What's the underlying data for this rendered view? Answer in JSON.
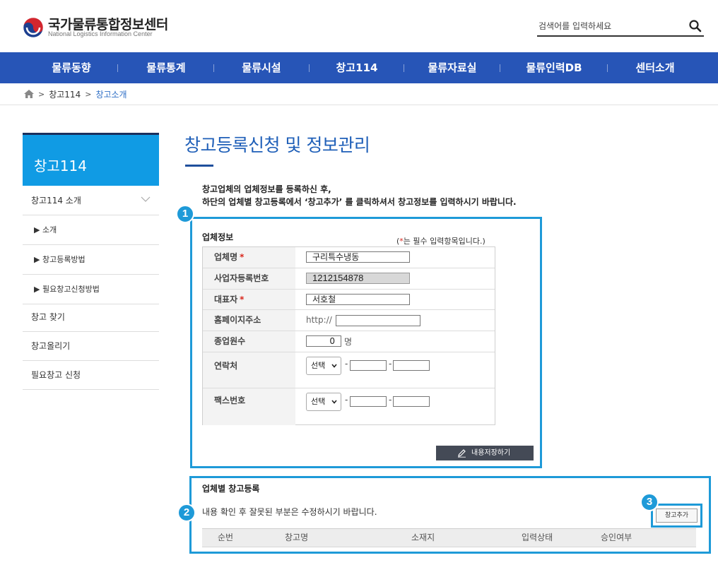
{
  "header": {
    "logo_ko": "국가물류통합정보센터",
    "logo_en": "National Logistics Information Center",
    "search_placeholder": "검색어를 입력하세요"
  },
  "nav": {
    "items": [
      "물류동향",
      "물류통계",
      "물류시설",
      "창고114",
      "물류자료실",
      "물류인력DB",
      "센터소개"
    ]
  },
  "breadcrumb": {
    "items": [
      "창고114",
      "창고소개"
    ]
  },
  "sidebar": {
    "title": "창고114",
    "items": [
      {
        "label": "창고114 소개"
      },
      {
        "label": "▶ 소개"
      },
      {
        "label": "▶ 창고등록방법"
      },
      {
        "label": "▶ 필요창고신청방법"
      },
      {
        "label": "창고 찾기"
      },
      {
        "label": "창고올리기"
      },
      {
        "label": "필요창고 신청"
      }
    ]
  },
  "main": {
    "title": "창고등록신청 및 정보관리",
    "intro_line1": "창고업체의 업체정보를 등록하신 후,",
    "intro_line2": "하단의 업체별 창고등록에서 ‘창고추가’ 를 클릭하셔서 창고정보를 입력하시기 바랍니다."
  },
  "company_info": {
    "section_title": "업체정보",
    "required_note_open": "(",
    "required_note_star": "*",
    "required_note_text": "는 필수 입력항목입니다.)",
    "fields": {
      "company_name": {
        "label": "업체명",
        "value": "구리특수냉동"
      },
      "business_no": {
        "label": "사업자등록번호",
        "value": "1212154878"
      },
      "ceo": {
        "label": "대표자",
        "value": "서호철"
      },
      "homepage": {
        "label": "홈페이지주소",
        "prefix": "http://",
        "value": ""
      },
      "employees": {
        "label": "종업원수",
        "value": "0",
        "unit": "명"
      },
      "contact": {
        "label": "연락처",
        "select_value": "선택"
      },
      "fax": {
        "label": "팩스번호",
        "select_value": "선택"
      }
    },
    "required_star": "*",
    "save_label": "내용저장하기"
  },
  "warehouse_list": {
    "section_title": "업체별 창고등록",
    "guide_text": "내용 확인 후 잘못된 부분은 수정하시기 바랍니다.",
    "add_label": "창고추가",
    "columns": [
      "순번",
      "창고명",
      "소재지",
      "입력상태",
      "승인여부"
    ]
  },
  "badges": [
    "1",
    "2",
    "3"
  ],
  "colors": {
    "nav_bg": "#2755b7",
    "sidebar_title_bg": "#109be4",
    "callout": "#1e9ad8",
    "title_blue": "#1f5fb8",
    "required_red": "#d9261c"
  }
}
